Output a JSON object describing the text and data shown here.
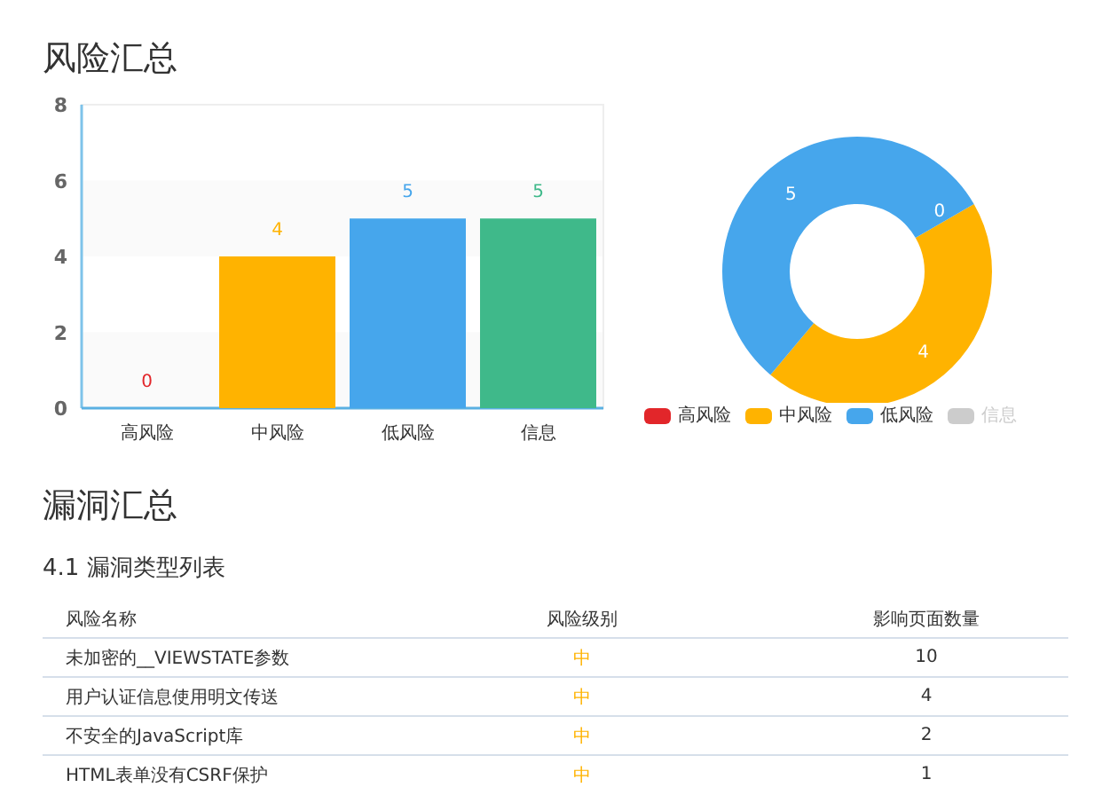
{
  "risk_summary": {
    "title": "风险汇总",
    "bar_chart": {
      "chart_data": {
        "type": "bar",
        "categories": [
          "高风险",
          "中风险",
          "低风险",
          "信息"
        ],
        "values": [
          0,
          4,
          5,
          5
        ],
        "ylim": [
          0,
          8
        ],
        "yticks": [
          0,
          2,
          4,
          6,
          8
        ],
        "data_labels": true
      }
    },
    "donut_chart": {
      "chart_data": {
        "type": "donut",
        "categories": [
          "高风险",
          "中风险",
          "低风险",
          "信息"
        ],
        "values": [
          0,
          4,
          5,
          null
        ],
        "value_labels": [
          "0",
          "4",
          "5",
          null
        ]
      }
    },
    "legend": [
      {
        "color": "#e2262a",
        "selected": true
      },
      {
        "color": "#ffb300",
        "selected": true
      },
      {
        "color": "#46a6ec",
        "selected": true
      },
      {
        "color": "#3fb98a",
        "selected": false
      }
    ]
  },
  "vuln_summary": {
    "title": "漏洞汇总",
    "subtitle": "4.1 漏洞类型列表",
    "table": {
      "columns": [
        "风险名称",
        "风险级别",
        "影响页面数量"
      ],
      "rows": [
        {
          "name": "未加密的__VIEWSTATE参数",
          "level": "中",
          "color": "#ffb300",
          "count": "10"
        },
        {
          "name": "用户认证信息使用明文传送",
          "level": "中",
          "color": "#ffb300",
          "count": "4"
        },
        {
          "name": "不安全的JavaScript库",
          "level": "中",
          "color": "#ffb300",
          "count": "2"
        },
        {
          "name": "HTML表单没有CSRF保护",
          "level": "中",
          "color": "#ffb300",
          "count": "1"
        }
      ]
    }
  }
}
